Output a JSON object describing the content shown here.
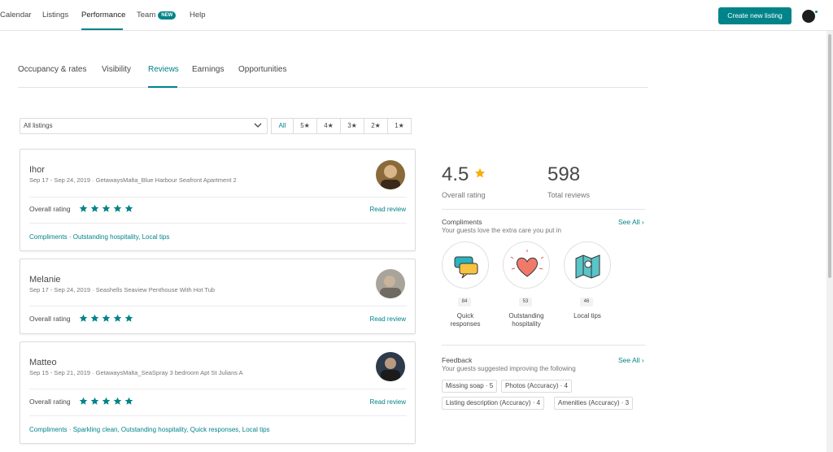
{
  "topnav": {
    "items": [
      "Calendar",
      "Listings",
      "Performance",
      "Team",
      "Help"
    ],
    "team_badge": "NEW",
    "create_button": "Create new listing"
  },
  "tabs": [
    "Occupancy & rates",
    "Visibility",
    "Reviews",
    "Earnings",
    "Opportunities"
  ],
  "filter": {
    "listing_select": "All listings",
    "ratings": [
      "All",
      "5★",
      "4★",
      "3★",
      "2★",
      "1★"
    ],
    "selected": "All"
  },
  "reviews": [
    {
      "name": "Ihor",
      "meta": "Sep 17 - Sep 24, 2019 · GetawaysMalta_Blue Harbour Seafront Apartment 2",
      "overall_label": "Overall rating",
      "stars": 5,
      "read_label": "Read review",
      "compliments": "Compliments · Outstanding hospitality, Local tips"
    },
    {
      "name": "Melanie",
      "meta": "Sep 17 - Sep 24, 2019 · Seashells Seaview Penthouse With Hot Tub",
      "overall_label": "Overall rating",
      "stars": 5,
      "read_label": "Read review",
      "compliments": ""
    },
    {
      "name": "Matteo",
      "meta": "Sep 15 - Sep 21, 2019 · GetawaysMalta_SeaSpray 3 bedroom Apt St Julians A",
      "overall_label": "Overall rating",
      "stars": 5,
      "read_label": "Read review",
      "compliments": "Compliments · Sparkling clean, Outstanding hospitality, Quick responses, Local tips"
    }
  ],
  "summary": {
    "rating": "4.5",
    "rating_label": "Overall rating",
    "total": "598",
    "total_label": "Total reviews"
  },
  "compliments": {
    "title": "Compliments",
    "subtitle": "Your guests love the extra care you put in",
    "see_all": "See All",
    "items": [
      {
        "count": "84",
        "label": "Quick responses",
        "icon": "chat-bubbles-icon"
      },
      {
        "count": "53",
        "label": "Outstanding hospitality",
        "icon": "heart-icon"
      },
      {
        "count": "46",
        "label": "Local tips",
        "icon": "map-icon"
      }
    ]
  },
  "feedback": {
    "title": "Feedback",
    "subtitle": "Your guests suggested improving the following",
    "see_all": "See All",
    "chips": [
      "Missing soap · 5",
      "Photos (Accuracy) · 4",
      "Listing description (Accuracy) · 4",
      "Amenities (Accuracy) · 3"
    ]
  },
  "colors": {
    "accent": "#008489",
    "star": "#F5B000"
  }
}
